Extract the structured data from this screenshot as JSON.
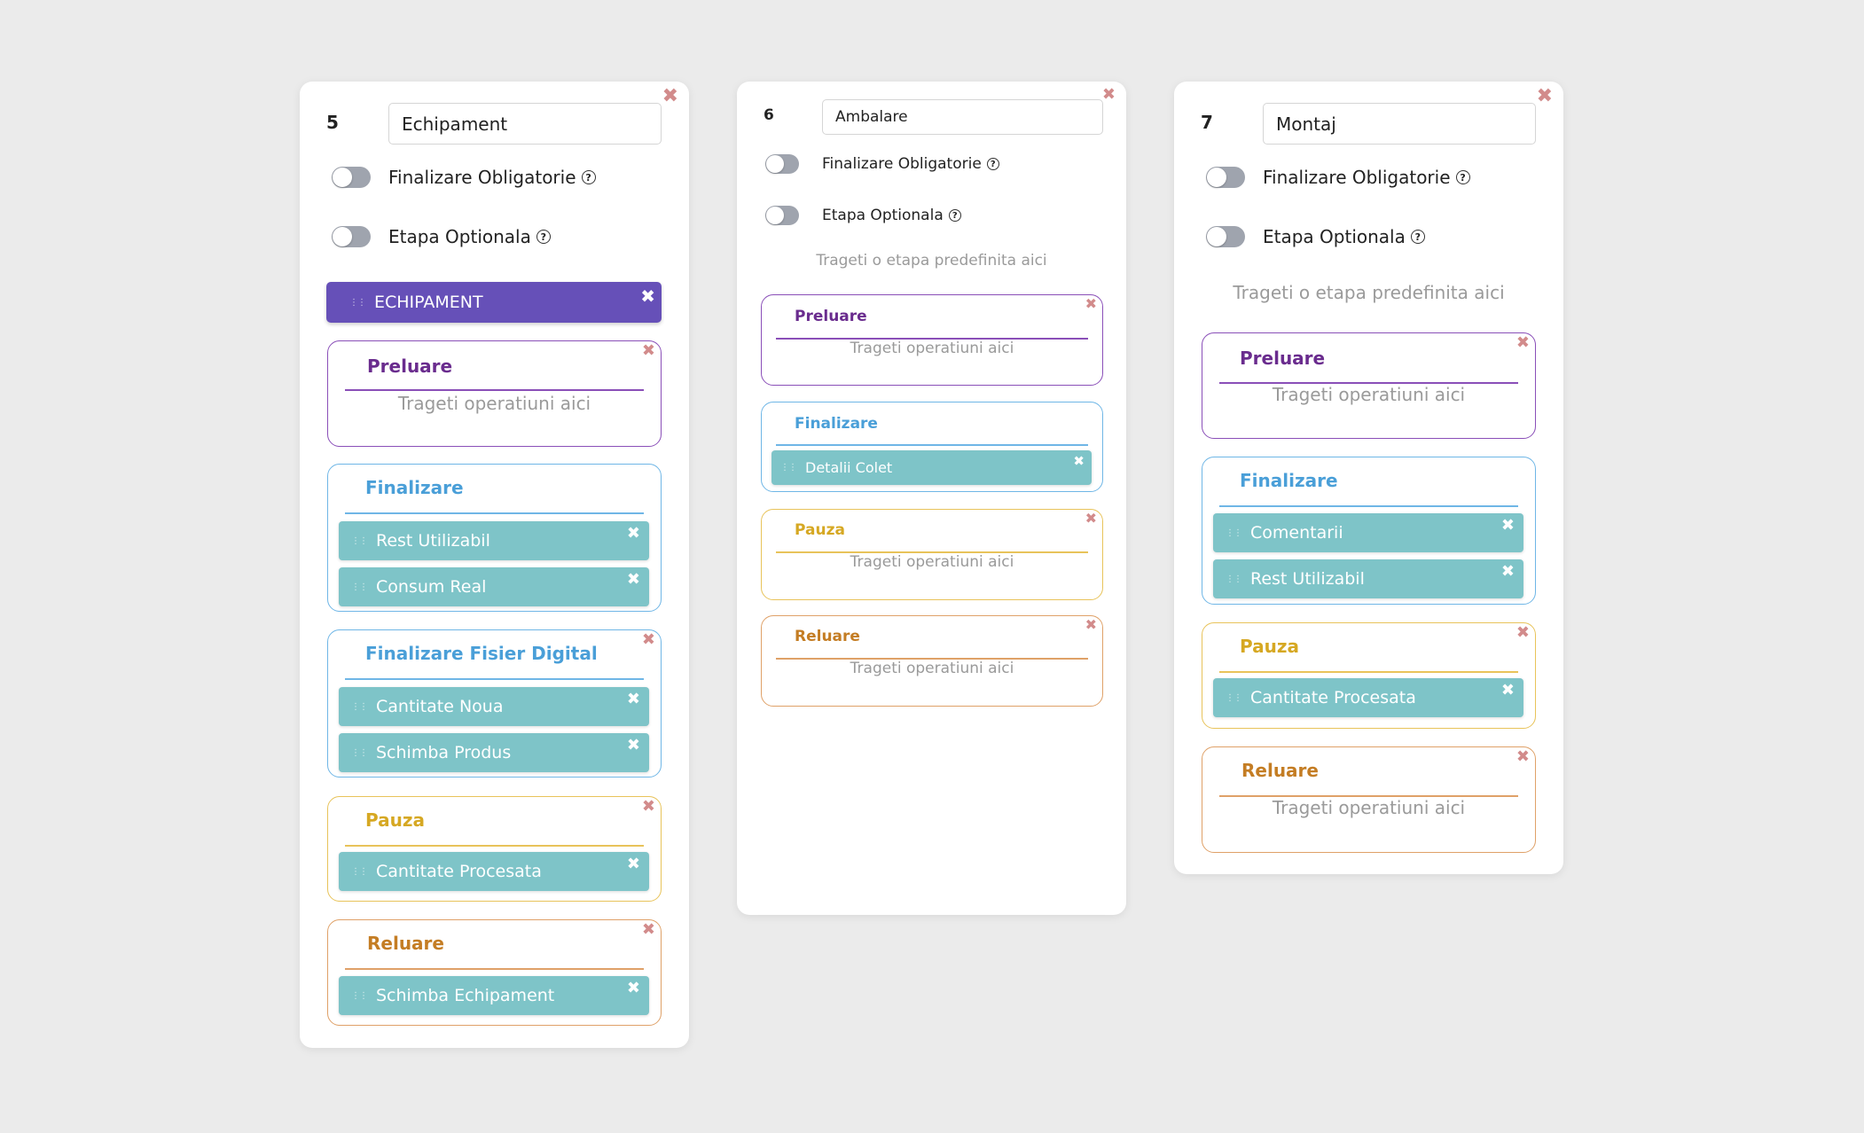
{
  "cards": [
    {
      "number": "5",
      "name": "Echipament",
      "toggle_mandatory": "Finalizare Obligatorie",
      "toggle_optional": "Etapa Optionala",
      "help_icon": "?",
      "close_icon": "✖",
      "predefined_stage": "ECHIPAMENT",
      "groups": [
        {
          "title": "Preluare",
          "hint": "Trageti operatiuni aici",
          "items": []
        },
        {
          "title": "Finalizare",
          "items": [
            "Rest Utilizabil",
            "Consum Real"
          ]
        },
        {
          "title": "Finalizare Fisier Digital",
          "items": [
            "Cantitate Noua",
            "Schimba Produs"
          ]
        },
        {
          "title": "Pauza",
          "items": [
            "Cantitate Procesata"
          ]
        },
        {
          "title": "Reluare",
          "items": [
            "Schimba Echipament"
          ]
        }
      ]
    },
    {
      "number": "6",
      "name": "Ambalare",
      "toggle_mandatory": "Finalizare Obligatorie",
      "toggle_optional": "Etapa Optionala",
      "help_icon": "?",
      "close_icon": "✖",
      "drop_hint": "Trageti o etapa predefinita aici",
      "groups": [
        {
          "title": "Preluare",
          "hint": "Trageti operatiuni aici",
          "items": []
        },
        {
          "title": "Finalizare",
          "items": [
            "Detalii Colet"
          ]
        },
        {
          "title": "Pauza",
          "hint": "Trageti operatiuni aici",
          "items": []
        },
        {
          "title": "Reluare",
          "hint": "Trageti operatiuni aici",
          "items": []
        }
      ]
    },
    {
      "number": "7",
      "name": "Montaj",
      "toggle_mandatory": "Finalizare Obligatorie",
      "toggle_optional": "Etapa Optionala",
      "help_icon": "?",
      "close_icon": "✖",
      "drop_hint": "Trageti o etapa predefinita aici",
      "groups": [
        {
          "title": "Preluare",
          "hint": "Trageti operatiuni aici",
          "items": []
        },
        {
          "title": "Finalizare",
          "items": [
            "Comentarii",
            "Rest Utilizabil"
          ]
        },
        {
          "title": "Pauza",
          "items": [
            "Cantitate Procesata"
          ]
        },
        {
          "title": "Reluare",
          "hint": "Trageti operatiuni aici",
          "items": []
        }
      ]
    }
  ],
  "colors": {
    "background": "#ebebeb",
    "predefined_stage": "#6650b8",
    "operation_chip": "#7ec4c8",
    "preluare": "#8a4fb8",
    "finalizare": "#6fb6e6",
    "pauza": "#e8c35a",
    "reluare": "#dfa168",
    "close_icon": "#d28b8b"
  },
  "icons": {
    "close": "close-icon",
    "help": "help-icon",
    "grip": "drag-handle-icon",
    "toggle": "toggle-switch"
  }
}
